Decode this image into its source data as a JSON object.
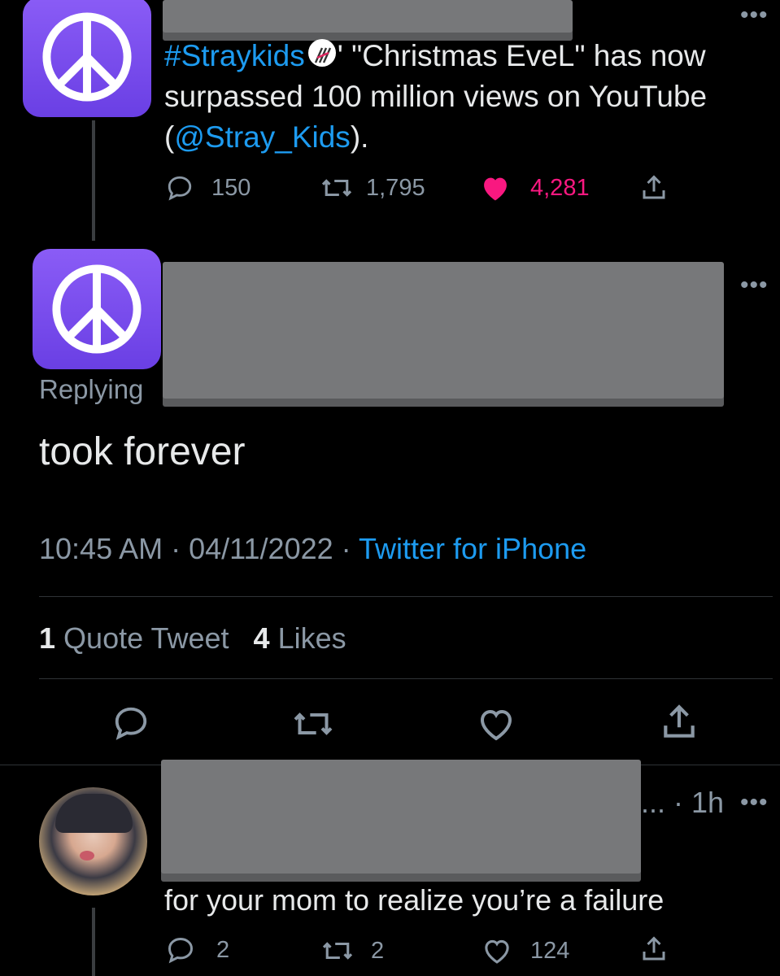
{
  "parent_tweet": {
    "hashtag": "#Straykids",
    "text_after_emoji": "' \"Christmas EveL\" has now",
    "line2": "surpassed 100 million views on YouTube",
    "paren_open": "(",
    "mention": "@Stray_Kids",
    "paren_close": ").",
    "replies": "150",
    "retweets": "1,795",
    "likes": "4,281"
  },
  "main_tweet": {
    "replying_label": "Replying",
    "text": "took forever",
    "time": "10:45 AM",
    "sep1": "·",
    "date": "04/11/2022",
    "sep2": "·",
    "source": "Twitter for iPhone",
    "quote_count": "1",
    "quote_label": "Quote Tweet",
    "likes_count": "4",
    "likes_label": "Likes"
  },
  "reply_tweet": {
    "truncation": "...",
    "time": "· 1h",
    "text": "for your mom to realize you’re a failure",
    "replies": "2",
    "retweets": "2",
    "likes": "124"
  },
  "more_dots": "•••",
  "colors": {
    "accent": "#1d9bf0",
    "like_active": "#f91880",
    "avatar_bg": "#7a4cf0"
  }
}
